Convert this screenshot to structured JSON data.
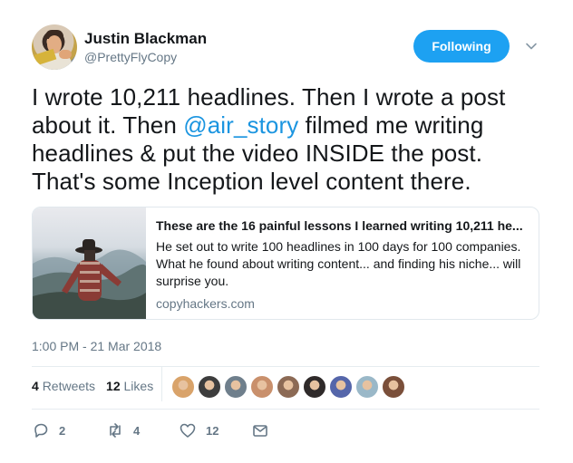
{
  "author": {
    "name": "Justin Blackman",
    "handle": "@PrettyFlyCopy"
  },
  "follow_button": {
    "label": "Following",
    "color": "#1da1f2"
  },
  "tweet": {
    "text_before": "I wrote 10,211 headlines. Then I wrote a post about it. Then ",
    "mention": "@air_story",
    "text_after": " filmed me writing headlines & put the video INSIDE the post. That's some Inception level content there."
  },
  "card": {
    "title": "These are the 16 painful lessons I learned writing 10,211 he...",
    "description": "He set out to write 100 headlines in 100 days for 100 companies. What he found about writing content... and finding his niche... will surprise you.",
    "domain": "copyhackers.com"
  },
  "timestamp": "1:00 PM - 21 Mar 2018",
  "stats": {
    "retweets_count": "4",
    "retweets_label": "Retweets",
    "likes_count": "12",
    "likes_label": "Likes"
  },
  "likers": [
    {
      "color": "#d9a36a"
    },
    {
      "color": "#3d3d3d"
    },
    {
      "color": "#6f7f8c"
    },
    {
      "color": "#c9906c"
    },
    {
      "color": "#8c6a55"
    },
    {
      "color": "#2f2a2a"
    },
    {
      "color": "#5566aa"
    },
    {
      "color": "#9ab8c8"
    },
    {
      "color": "#7a4f3a"
    }
  ],
  "actions": {
    "reply_count": "2",
    "retweet_count": "4",
    "like_count": "12"
  },
  "icons": {
    "caret": "chevron-down-icon",
    "reply": "reply-icon",
    "retweet": "retweet-icon",
    "like": "heart-icon",
    "dm": "envelope-icon"
  }
}
